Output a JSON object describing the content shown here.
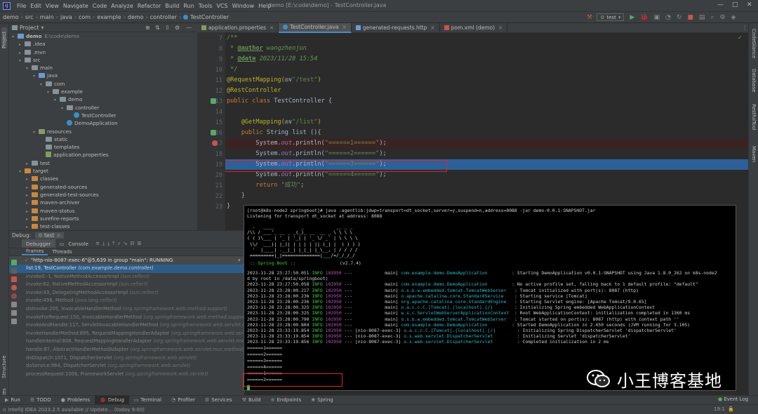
{
  "menubar": {
    "items": [
      "File",
      "Edit",
      "View",
      "Navigate",
      "Code",
      "Analyze",
      "Refactor",
      "Build",
      "Run",
      "Tools",
      "VCS",
      "Window",
      "Help"
    ],
    "title": "demo [E:\\code\\demo] - TestController.java"
  },
  "navbar": {
    "crumbs": [
      "demo",
      "src",
      "main",
      "java",
      "com",
      "example",
      "demo",
      "controller",
      "TestController"
    ],
    "run_config": "test"
  },
  "project": {
    "header": "Project",
    "tree": [
      {
        "label": "demo",
        "extra": "E:\\code\\demo",
        "depth": 0,
        "icon": "module",
        "open": true
      },
      {
        "label": ".idea",
        "depth": 1,
        "icon": "folder",
        "open": false
      },
      {
        "label": ".mvn",
        "depth": 1,
        "icon": "folder",
        "open": false
      },
      {
        "label": "src",
        "depth": 1,
        "icon": "folder",
        "open": true
      },
      {
        "label": "main",
        "depth": 2,
        "icon": "folder",
        "open": true
      },
      {
        "label": "java",
        "depth": 3,
        "icon": "blue",
        "open": true
      },
      {
        "label": "com",
        "depth": 4,
        "icon": "folder",
        "open": true
      },
      {
        "label": "example",
        "depth": 5,
        "icon": "folder",
        "open": true
      },
      {
        "label": "demo",
        "depth": 6,
        "icon": "folder",
        "open": true
      },
      {
        "label": "controller",
        "depth": 7,
        "icon": "folder",
        "open": true
      },
      {
        "label": "TestController",
        "depth": 8,
        "icon": "class",
        "open": null
      },
      {
        "label": "DemoApplication",
        "depth": 7,
        "icon": "class",
        "open": null
      },
      {
        "label": "resources",
        "depth": 3,
        "icon": "res",
        "open": true
      },
      {
        "label": "static",
        "depth": 4,
        "icon": "folder",
        "open": null
      },
      {
        "label": "templates",
        "depth": 4,
        "icon": "folder",
        "open": null
      },
      {
        "label": "application.properties",
        "depth": 4,
        "icon": "prop",
        "open": null
      },
      {
        "label": "test",
        "depth": 2,
        "icon": "folder",
        "open": false
      },
      {
        "label": "target",
        "depth": 1,
        "icon": "orange",
        "open": true
      },
      {
        "label": "classes",
        "depth": 2,
        "icon": "orange",
        "open": false
      },
      {
        "label": "generated-sources",
        "depth": 2,
        "icon": "orange",
        "open": false
      },
      {
        "label": "generated-test-sources",
        "depth": 2,
        "icon": "orange",
        "open": false
      },
      {
        "label": "maven-archiver",
        "depth": 2,
        "icon": "orange",
        "open": false
      },
      {
        "label": "maven-status",
        "depth": 2,
        "icon": "orange",
        "open": false
      },
      {
        "label": "surefire-reports",
        "depth": 2,
        "icon": "orange",
        "open": false
      },
      {
        "label": "test-classes",
        "depth": 2,
        "icon": "orange",
        "open": false
      }
    ]
  },
  "editor": {
    "tabs": [
      {
        "label": "application.properties",
        "active": false
      },
      {
        "label": "TestController.java",
        "active": true
      },
      {
        "label": "generated-requests.http",
        "active": false
      },
      {
        "label": "pom.xml (demo)",
        "active": false
      }
    ],
    "line_numbers": [
      "7",
      "8",
      "9",
      "10",
      "11",
      "12",
      "13",
      "14",
      "15",
      "16",
      "17",
      "18",
      "19",
      "20",
      "21",
      "22",
      "23"
    ],
    "lines": [
      [
        [
          "/**",
          "cm"
        ]
      ],
      [
        [
          " * ",
          "cm"
        ],
        [
          "@author",
          "dt"
        ],
        [
          " wangzhenjun",
          "cm"
        ]
      ],
      [
        [
          " * ",
          "cm"
        ],
        [
          "@date",
          "dt"
        ],
        [
          " 2023/11/28 15:54",
          "cm"
        ]
      ],
      [
        [
          " */",
          "cm"
        ]
      ],
      [
        [
          "@RequestMapping(",
          "an"
        ],
        [
          "◎∨",
          "plain"
        ],
        [
          "\"/test\"",
          "str"
        ],
        [
          ")",
          "an"
        ]
      ],
      [
        [
          "@RestController",
          "an"
        ]
      ],
      [
        [
          "public class ",
          "kw"
        ],
        [
          "TestController {",
          "plain"
        ]
      ],
      [
        [
          "",
          "plain"
        ]
      ],
      [
        [
          "    @GetMapping(",
          "an"
        ],
        [
          "◎∨",
          "plain"
        ],
        [
          "\"/list\"",
          "str"
        ],
        [
          ")",
          "an"
        ]
      ],
      [
        [
          "    public ",
          "kw"
        ],
        [
          "String list (){",
          "plain"
        ]
      ],
      [
        [
          "        System.",
          "plain"
        ],
        [
          "out",
          "fld"
        ],
        [
          ".println(",
          "plain"
        ],
        [
          "\"======1======\"",
          "str"
        ],
        [
          ");",
          "plain"
        ]
      ],
      [
        [
          "        System.",
          "plain"
        ],
        [
          "out",
          "fld"
        ],
        [
          ".println(",
          "plain"
        ],
        [
          "\"======2======\"",
          "str"
        ],
        [
          ");",
          "plain"
        ]
      ],
      [
        [
          "        System.",
          "plain"
        ],
        [
          "out",
          "fld"
        ],
        [
          ".println(",
          "plain"
        ],
        [
          "\"======3======\"",
          "str"
        ],
        [
          ");",
          "plain"
        ]
      ],
      [
        [
          "        System.",
          "plain"
        ],
        [
          "out",
          "fld"
        ],
        [
          ".println(",
          "plain"
        ],
        [
          "\"======4======\"",
          "str"
        ],
        [
          ");",
          "plain"
        ]
      ],
      [
        [
          "        return ",
          "kw"
        ],
        [
          "\"成功\"",
          "str"
        ],
        [
          ";",
          "plain"
        ]
      ],
      [
        [
          "    }",
          "plain"
        ]
      ],
      [
        [
          "}",
          "plain"
        ]
      ]
    ]
  },
  "debug": {
    "label": "Debug:",
    "config": "test",
    "tabs": [
      "Debugger",
      "Console"
    ],
    "subtabs": [
      "Frames",
      "Threads"
    ],
    "thread": "\"http-nio-8087-exec-6\"@5,639 in group \"main\": RUNNING",
    "frames": [
      {
        "m": "list:19, TestController",
        "c": "(com.example.demo.controller)"
      },
      {
        "m": "invoke0:-1, NativeMethodAccessorImpl",
        "c": "(sun.reflect)"
      },
      {
        "m": "invoke:62, NativeMethodAccessorImpl",
        "c": "(sun.reflect)"
      },
      {
        "m": "invoke:43, DelegatingMethodAccessorImpl",
        "c": "(sun.reflect)"
      },
      {
        "m": "invoke:498, Method",
        "c": "(java.lang.reflect)"
      },
      {
        "m": "doInvoke:205, InvocableHandlerMethod",
        "c": "(org.springframework.web.method.support)"
      },
      {
        "m": "invokeForRequest:150, InvocableHandlerMethod",
        "c": "(org.springframework.web.method.support)"
      },
      {
        "m": "invokeAndHandle:117, ServletInvocableHandlerMethod",
        "c": "(org.springframework.web.servlet.mvc.method)"
      },
      {
        "m": "invokeHandlerMethod:895, RequestMappingHandlerAdapter",
        "c": "(org.springframework.web.servlet.mvc.metho"
      },
      {
        "m": "handleInternal:808, RequestMappingHandlerAdapter",
        "c": "(org.springframework.web.servlet.mvc.method)"
      },
      {
        "m": "handle:87, AbstractHandlerMethodAdapter",
        "c": "(org.springframework.web.servlet.mvc.method)"
      },
      {
        "m": "doDispatch:1071, DispatcherServlet",
        "c": "(org.springframework.web.servlet)"
      },
      {
        "m": "doService:964, DispatcherServlet",
        "c": "(org.springframework.web.servlet)"
      },
      {
        "m": "processRequest:1006, FrameworkServlet",
        "c": "(org.springframework.web.servlet)"
      }
    ]
  },
  "terminal": {
    "cmd": "[root@k8s-node2 springboot]# java -agentlib:jdwp=transport=dt_socket,server=y,suspend=n,address=8088 -jar demo-0.0.1-SNAPSHOT.jar",
    "listen": "Listening for transport dt_socket at address: 8088",
    "banner": [
      "  .   ____          _            __ _ _",
      "/\\\\ / ___'_ __ _ _(_)_ __  __ _ \\ \\ \\ \\",
      "( ( )\\___ | '_ | '_| | '_ \\/ _` | \\ \\ \\ \\",
      " \\\\/  ___)| |_)| | | | | || (_| |  ) ) ) )",
      "  '  |____| .__|_| |_|_| |_\\__, | / / / /",
      " =========|_|==============|___/=/_/_/_/"
    ],
    "springboot": " :: Spring Boot ::",
    "version": "(v2.7.4)",
    "logs": [
      {
        "ts": "2023-11-28 23:27:50.051",
        "lvl": "INFO",
        "pid": "102950",
        "th": "           main]",
        "cls": "com.example.demo.DemoApplication        ",
        "msg": ": Starting DemoApplication v0.0.1-SNAPSHOT using Java 1.8.0_262 on k8s-node2"
      },
      {
        "ts": "d by root in /data/springboot)",
        "lvl": "",
        "pid": "",
        "th": "",
        "cls": "",
        "msg": ""
      },
      {
        "ts": "2023-11-28 23:27:50.058",
        "lvl": "INFO",
        "pid": "102950",
        "th": "           main]",
        "cls": "com.example.demo.DemoApplication        ",
        "msg": ": No active profile set, falling back to 1 default profile: \"default\""
      },
      {
        "ts": "2023-11-28 23:28:00.217",
        "lvl": "INFO",
        "pid": "102950",
        "th": "           main]",
        "cls": "o.s.b.w.embedded.tomcat.TomcatWebServer  ",
        "msg": ": Tomcat initialized with port(s): 8087 (http)"
      },
      {
        "ts": "2023-11-28 23:28:00.236",
        "lvl": "INFO",
        "pid": "102950",
        "th": "           main]",
        "cls": "o.apache.catalina.core.StandardService   ",
        "msg": ": Starting service [Tomcat]"
      },
      {
        "ts": "2023-11-28 23:28:00.236",
        "lvl": "INFO",
        "pid": "102950",
        "th": "           main]",
        "cls": "org.apache.catalina.core.StandardEngine  ",
        "msg": ": Starting Servlet engine: [Apache Tomcat/9.0.65]"
      },
      {
        "ts": "2023-11-28 23:28:00.325",
        "lvl": "INFO",
        "pid": "102950",
        "th": "           main]",
        "cls": "o.a.c.c.C.[Tomcat].[localhost].[/]       ",
        "msg": ": Initializing Spring embedded WebApplicationContext"
      },
      {
        "ts": "2023-11-28 23:28:00.325",
        "lvl": "INFO",
        "pid": "102950",
        "th": "           main]",
        "cls": "w.s.c.ServletWebServerApplicationContext ",
        "msg": ": Root WebApplicationContext: initialization completed in 1360 ms"
      },
      {
        "ts": "2023-11-28 23:28:00.790",
        "lvl": "INFO",
        "pid": "102950",
        "th": "           main]",
        "cls": "o.s.b.w.embedded.tomcat.TomcatWebServer  ",
        "msg": ": Tomcat started on port(s): 8087 (http) with context path ''"
      },
      {
        "ts": "2023-11-28 23:28:00.804",
        "lvl": "INFO",
        "pid": "102950",
        "th": "           main]",
        "cls": "com.example.demo.DemoApplication        ",
        "msg": ": Started DemoApplication in 2.450 seconds (JVM running for 3.105)"
      },
      {
        "ts": "2023-11-28 23:33:19.854",
        "lvl": "INFO",
        "pid": "102950",
        "th": "[nio-8087-exec-3]",
        "cls": "o.a.c.c.C.[Tomcat].[localhost].[/]       ",
        "msg": ": Initializing Spring DispatcherServlet 'dispatcherServlet'"
      },
      {
        "ts": "2023-11-28 23:33:19.854",
        "lvl": "INFO",
        "pid": "102950",
        "th": "[nio-8087-exec-3]",
        "cls": "o.s.web.servlet.DispatcherServlet        ",
        "msg": ": Initializing Servlet 'dispatcherServlet'"
      },
      {
        "ts": "2023-11-28 23:33:19.856",
        "lvl": "INFO",
        "pid": "102950",
        "th": "[nio-8087-exec-3]",
        "cls": "o.s.web.servlet.DispatcherServlet        ",
        "msg": ": Completed initialization in 2 ms"
      }
    ],
    "outputs": [
      "======1======",
      "======2======",
      "======3======",
      "======4======",
      "======1======",
      "======2======"
    ]
  },
  "bottom_tabs": [
    "Run",
    "TODO",
    "Problems",
    "Debug",
    "Terminal",
    "Profiler",
    "Services",
    "Build",
    "Endpoints",
    "Spring"
  ],
  "status": {
    "left": "IntelliJ IDEA 2023.2.5 available // Update... (today 9:00)",
    "position": "19:1",
    "encoding": "LF  UTF-8  4 spaces",
    "event_log": "Event Log"
  },
  "watermark": "小王博客基地",
  "right_tools": [
    "CodeGlance",
    "Database",
    "RestfulTool",
    "Maven"
  ],
  "left_tools": [
    "Project",
    "Structure",
    "Favorites"
  ]
}
